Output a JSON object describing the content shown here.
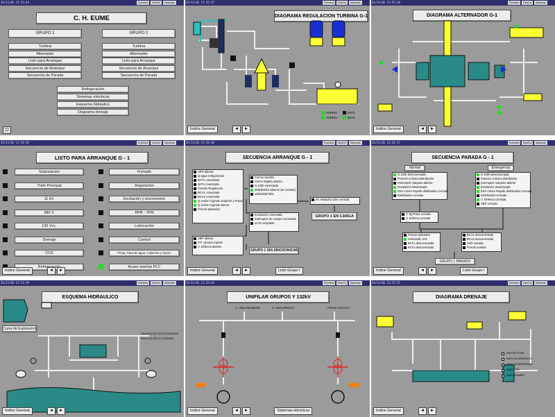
{
  "topbar": {
    "clock_labels": [
      "26/11/02 11:55:44",
      "26/11/02 11:55:27",
      "26/11/02 11:55:10",
      "26/11/02 11:54:56",
      "26/11/02 11:54:40",
      "26/11/02 11:54:17",
      "26/11/02 11:53:59",
      "26/11/02 11:53:44",
      "26/11/02 11:52:55"
    ],
    "eventos": "Eventos",
    "desc": "DesCo",
    "alarmas": "Alarmas"
  },
  "common": {
    "indice_general": "Indice General",
    "prev_arrow": "◄",
    "next_arrow": "►"
  },
  "p1": {
    "title": "C. H.  EUME",
    "grupo1": "GRUPO 1",
    "grupo2": "GRUPO 2",
    "grupo1_items": [
      "Turbina",
      "Alternador",
      "Listo para Arranque",
      "Secuencia de Arranque",
      "Secuencia de Parada"
    ],
    "grupo2_items": [
      "Turbina",
      "Alternador",
      "Listo para Arranque",
      "Secuencia de Arranque",
      "Secuencia de Parada"
    ],
    "general_items": [
      "Refrigeración",
      "Sistemas eléctricos",
      "Esquema hidráulico",
      "Diagrama drenaje"
    ]
  },
  "p2": {
    "title": "DIAGRAMA REGULACION TURBINA G-1",
    "legend": [
      "AVERIA",
      "MAR",
      "AVERIA",
      "BAT1",
      "BAT2"
    ]
  },
  "p3": {
    "title": "DIAGRAMA ALTERNADOR G-1"
  },
  "p4": {
    "title": "LISTO PARA ARRANQUE  G - 1",
    "left": [
      "Subestación",
      "Trafo Principal",
      "11 kV.",
      "380 V.",
      "125 Vcc.",
      "Drenaje",
      "CO2",
      "Refrigeración"
    ],
    "right": [
      "Frenado",
      "Regulación",
      "Excitación y sincronismo",
      "PPR - TPR",
      "Lubricación",
      "Control",
      "Presa, Toma de agua, Cabecera y Socaz.",
      "Acuse averías PLC"
    ]
  },
  "p5": {
    "title": "SECUENCIA ARRANQUE  G - 1",
    "box1": [
      "VRP abierta",
      "Q agua refrigeración",
      "BHT1 conectada",
      "BAT2 conectada",
      "Presión Regulación",
      "BCA1 conectada",
      "BCA2 conectada",
      "Q Aceite Cojinete Superior y Punta",
      "Q Aceite Cojinete Menor",
      "Frenos aplicados"
    ],
    "box2": [
      "Frenos Sueltos",
      "Cierre Rápido abierto",
      "N 1000 conectada",
      "Distribuidor abierto (no cerrado)",
      "Velocidad 95%"
    ],
    "box3": [
      "Excitación conectada",
      "Interruptor de Campo conectado",
      "11 kV acoplado"
    ],
    "box4": [
      "VBP abierta",
      "P.P. cámara espiral",
      "V. Esferica abierta"
    ],
    "box5": [
      "Int. Maquina 11kv cerrada"
    ],
    "carga": "GRUPO 1 EN CARGA",
    "sincr": "GRUPO 1 SIN SINCRONIZAR",
    "listo": "Listo Grupo I"
  },
  "p6": {
    "title": "SECUENCIA PARADA  G - 1",
    "normal": "Normal",
    "emergencia": "Emergencia",
    "boxN": [
      "N 1000 desconectada",
      "Posición mínima distribuidor",
      "Interruptor máquina abierto",
      "Excitación desactivada",
      "ESV Cierre Rápido distribuidor Cerrado",
      "Distribuidor Cerrado"
    ],
    "boxE": [
      "N 1000 desconectada",
      "Posición mínima distribuidor",
      "Interruptor máquina abierto",
      "Excitación desactivada",
      "ESV Cierre Rápido distribuidor Cerrado",
      "Distribuidor Cerrado",
      "V. Esferica Cerrada",
      "VBP cerrada"
    ],
    "boxM": [
      "V. By-Pass cerrada",
      "V. Esferica cerrada"
    ],
    "boxL": [
      "Frenos aplicados",
      "Velocidad <2%",
      "BAT1 desconectada",
      "BAT2 desconectada"
    ],
    "boxR": [
      "BCA1 desconectada",
      "BCA2 desconectada",
      "VAR cerrada",
      "Frenos sueltos"
    ],
    "parado": "GRUPO 1 PARADO",
    "listo": "Listo Grupo I"
  },
  "p7": {
    "title": "ESQUEMA HIDRAULICO",
    "curva": "Curva de Explotación",
    "legend": [
      "VALVULA NO SELECCIONADA",
      "VALVULA SELECCIONADA"
    ]
  },
  "p8": {
    "title": "UNIFILAR GRUPOS Y 132kV",
    "lines": [
      "S. LINEA\nBEMBIBRE",
      "S. LINEA\nRIBEIRO",
      "PRESA\nCORVEZO"
    ],
    "sistemas": "Sistemas eléctricos"
  },
  "p9": {
    "title": "DIAGRAMA DRENAJE",
    "legend": [
      "PROTECCIÓN",
      "NIVEL ALARMA ALTA",
      "NIVEL ALARMA BAJA",
      "NIVEL MIN",
      "NIVEL MINIMO"
    ]
  },
  "colors": {
    "panel": "#9b9b9b",
    "yellow": "#ffff33",
    "teal": "#2a8a88",
    "blue": "#1a2fd0",
    "green": "#22dd22",
    "pipe": "#e8e8e8"
  }
}
